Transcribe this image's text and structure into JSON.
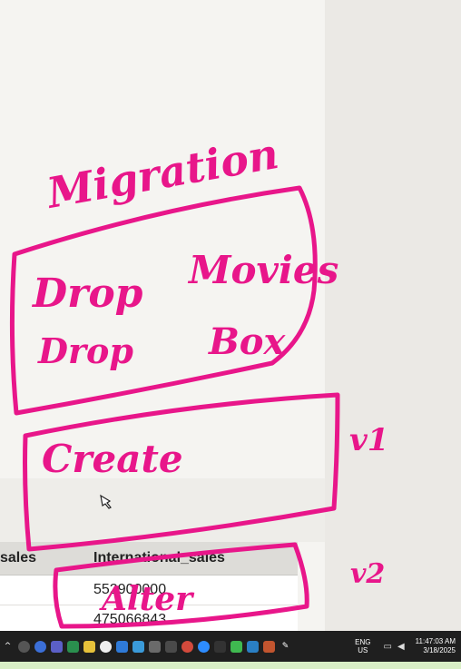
{
  "table": {
    "headers": [
      "sales",
      "International_sales"
    ],
    "rows": [
      [
        "",
        "552900000"
      ],
      [
        "",
        "475066843"
      ]
    ]
  },
  "ink": {
    "color": "#e8168a",
    "words": {
      "title": "Migration",
      "drop": "Drop",
      "movies": "Movies",
      "drop2": "Drop",
      "box": "Box",
      "create": "Create",
      "v1": "v1",
      "v2": "v2",
      "alter": "Alter"
    }
  },
  "taskbar": {
    "icons": [
      "chevron-up-icon",
      "headset-icon",
      "circle-icon",
      "teams-icon",
      "drive-icon",
      "maps-icon",
      "store-icon",
      "explorer-icon",
      "files-icon",
      "code-icon",
      "app-icon",
      "chrome-icon",
      "zoom-icon",
      "terminal-icon",
      "signal-icon",
      "shield-icon",
      "mic-icon",
      "pen-icon"
    ],
    "language_top": "ENG",
    "language_bottom": "US",
    "time": "11:47:03 AM",
    "date": "3/18/2025"
  }
}
